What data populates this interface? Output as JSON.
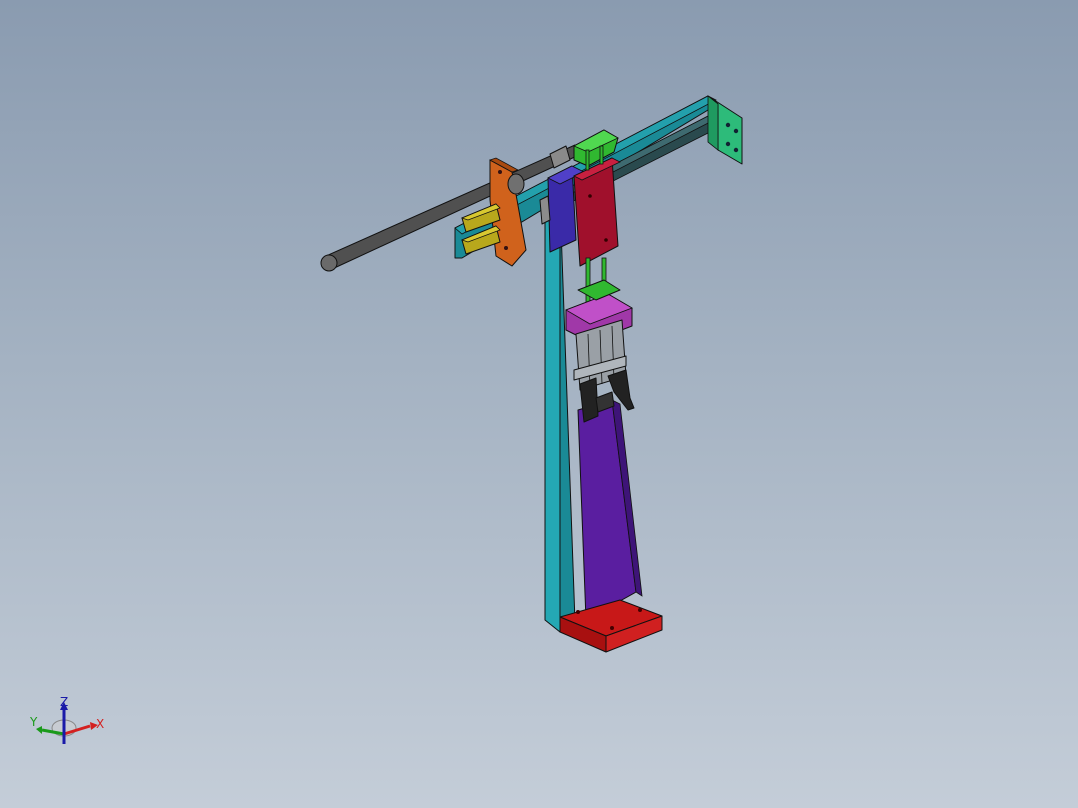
{
  "view": {
    "background_top": "#8a9bb0",
    "background_bottom": "#c4cdd8"
  },
  "triad": {
    "x_label": "X",
    "y_label": "Y",
    "z_label": "Z",
    "x_color": "#d42020",
    "y_color": "#1a9a1a",
    "z_color": "#1a1aa8"
  },
  "parts": {
    "column": "#1a8a96",
    "rail_plate": "#1a8a96",
    "end_bracket": "#2dbb7a",
    "base_block": "#c81818",
    "strut": "#5a1ea0",
    "motor_block": "#3a2aa8",
    "carriage": "#a0102c",
    "rod": "#505050",
    "flange": "#d0621c",
    "clamp_pads": "#b8a81c",
    "gripper_top": "#a038a8",
    "guide_posts": "#30b830",
    "gripper_fingers": "#222222"
  }
}
